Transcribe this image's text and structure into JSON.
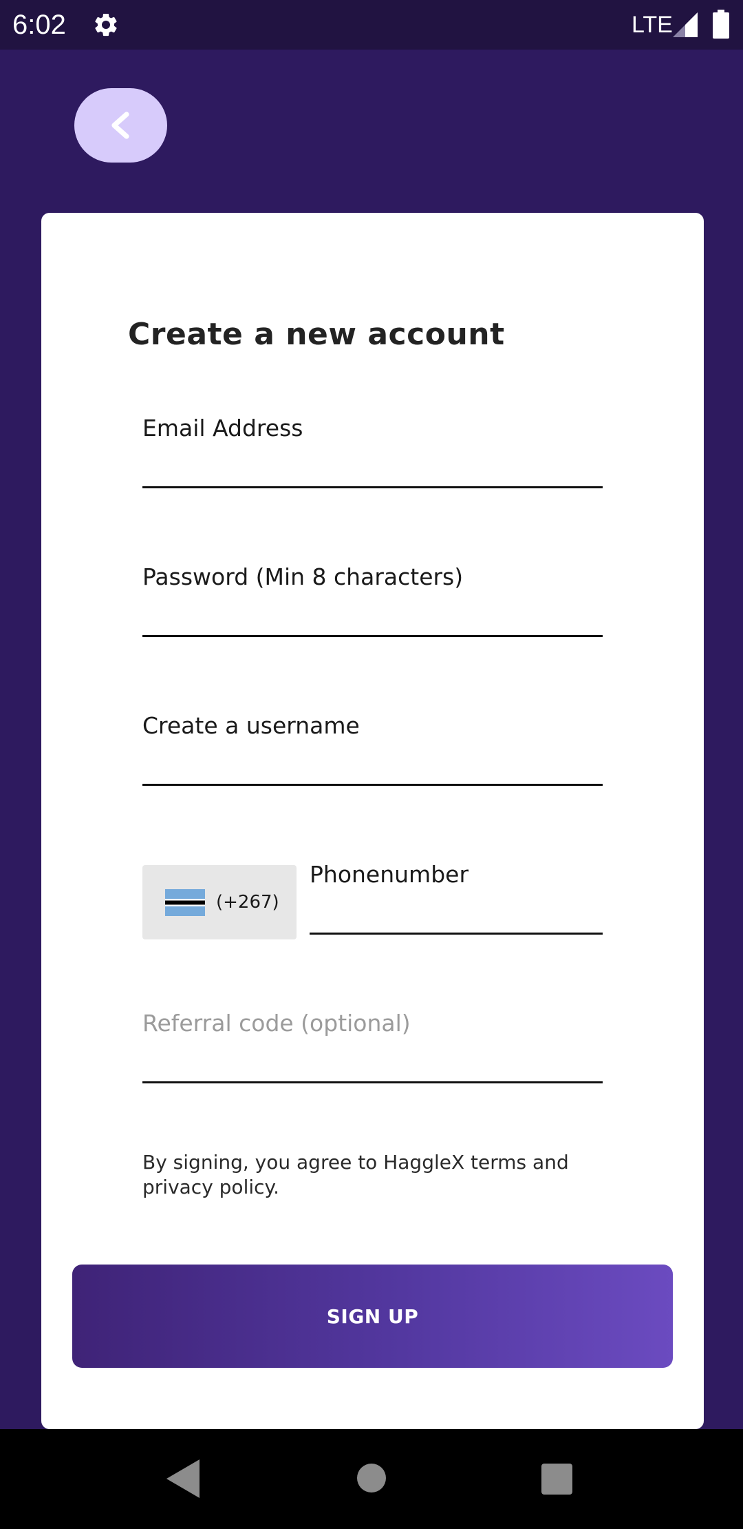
{
  "status_bar": {
    "time": "6:02",
    "network": "LTE",
    "icons": [
      "gear-icon",
      "signal-icon",
      "battery-icon"
    ]
  },
  "header": {
    "back_icon": "chevron-left-icon"
  },
  "form": {
    "title": "Create a new account",
    "email_label": "Email Address",
    "email_value": "",
    "password_label": "Password (Min 8 characters)",
    "password_value": "",
    "username_label": "Create a username",
    "username_value": "",
    "country_code": "(+267)",
    "country_flag_icon": "botswana-flag-icon",
    "phone_label": "Phonenumber",
    "phone_value": "",
    "referral_placeholder": "Referral code (optional)",
    "referral_value": "",
    "terms_text": "By signing, you agree to HaggleX terms and privacy policy.",
    "submit_label": "SIGN UP"
  },
  "nav_bar": {
    "icons": [
      "nav-back-icon",
      "nav-home-icon",
      "nav-recents-icon"
    ]
  },
  "colors": {
    "background": "#2e1a5f",
    "status_bar": "#211341",
    "back_button": "#d7cbfb",
    "button_gradient_start": "#3f2377",
    "button_gradient_end": "#6b4bc0"
  }
}
